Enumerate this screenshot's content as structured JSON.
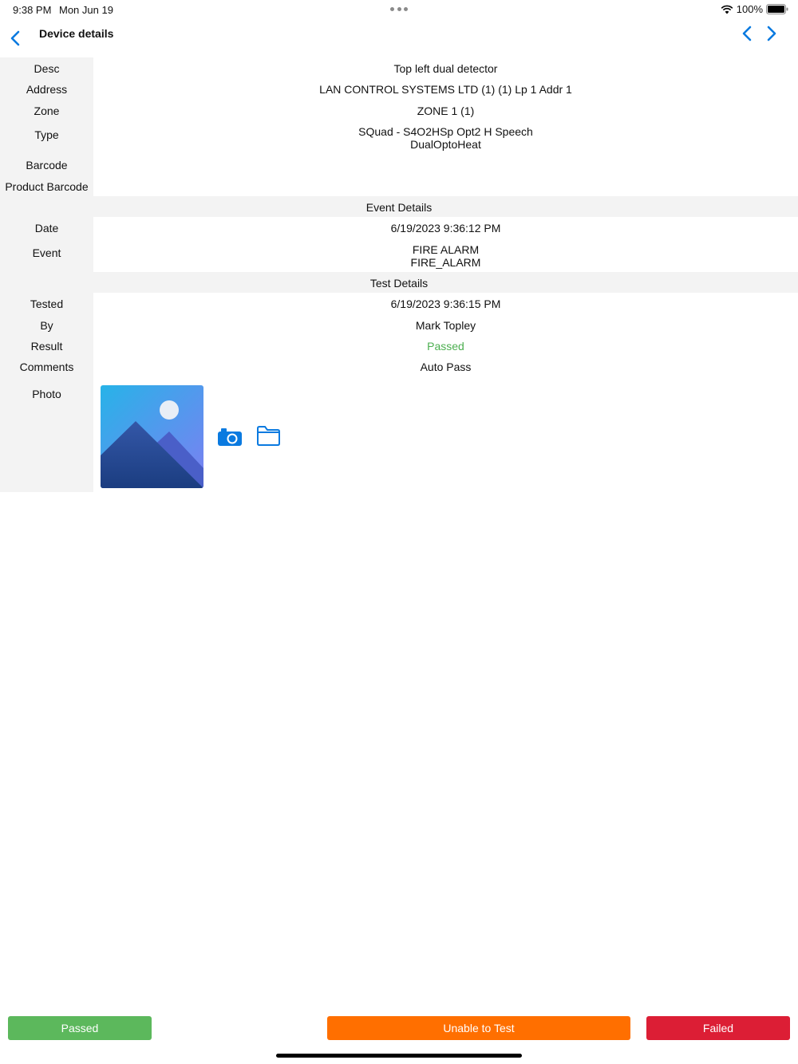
{
  "status_bar": {
    "time": "9:38 PM",
    "date": "Mon Jun 19",
    "battery": "100%"
  },
  "nav": {
    "title": "Device details"
  },
  "device": {
    "desc_label": "Desc",
    "desc_value": "Top left dual detector",
    "address_label": "Address",
    "address_value": "LAN CONTROL SYSTEMS LTD (1) (1) Lp 1 Addr 1",
    "zone_label": "Zone",
    "zone_value": "ZONE 1 (1)",
    "type_label": "Type",
    "type_value_line1": "SQuad - S4O2HSp Opt2 H Speech",
    "type_value_line2": "DualOptoHeat",
    "barcode_label": "Barcode",
    "barcode_value": "",
    "product_barcode_label": "Product Barcode",
    "product_barcode_value": ""
  },
  "event_details": {
    "header": "Event Details",
    "date_label": "Date",
    "date_value": "6/19/2023 9:36:12 PM",
    "event_label": "Event",
    "event_value_line1": "FIRE ALARM",
    "event_value_line2": "FIRE_ALARM"
  },
  "test_details": {
    "header": "Test Details",
    "tested_label": "Tested",
    "tested_value": "6/19/2023 9:36:15 PM",
    "by_label": "By",
    "by_value": "Mark Topley",
    "result_label": "Result",
    "result_value": "Passed",
    "comments_label": "Comments",
    "comments_value": "Auto Pass",
    "photo_label": "Photo"
  },
  "icons": {
    "back": "chevron-left-icon",
    "previous": "chevron-left-icon",
    "next": "chevron-right-icon",
    "camera": "camera-icon",
    "folder": "folder-icon",
    "photo_placeholder": "image-placeholder-icon"
  },
  "actions": {
    "passed_label": "Passed",
    "unable_label": "Unable to Test",
    "failed_label": "Failed"
  },
  "colors": {
    "accent": "#0a7ae0",
    "passed": "#5cb85c",
    "result_passed_text": "#4caf50",
    "unable": "#ff6f00",
    "failed": "#dc1e35",
    "label_bg": "#f3f3f3"
  }
}
